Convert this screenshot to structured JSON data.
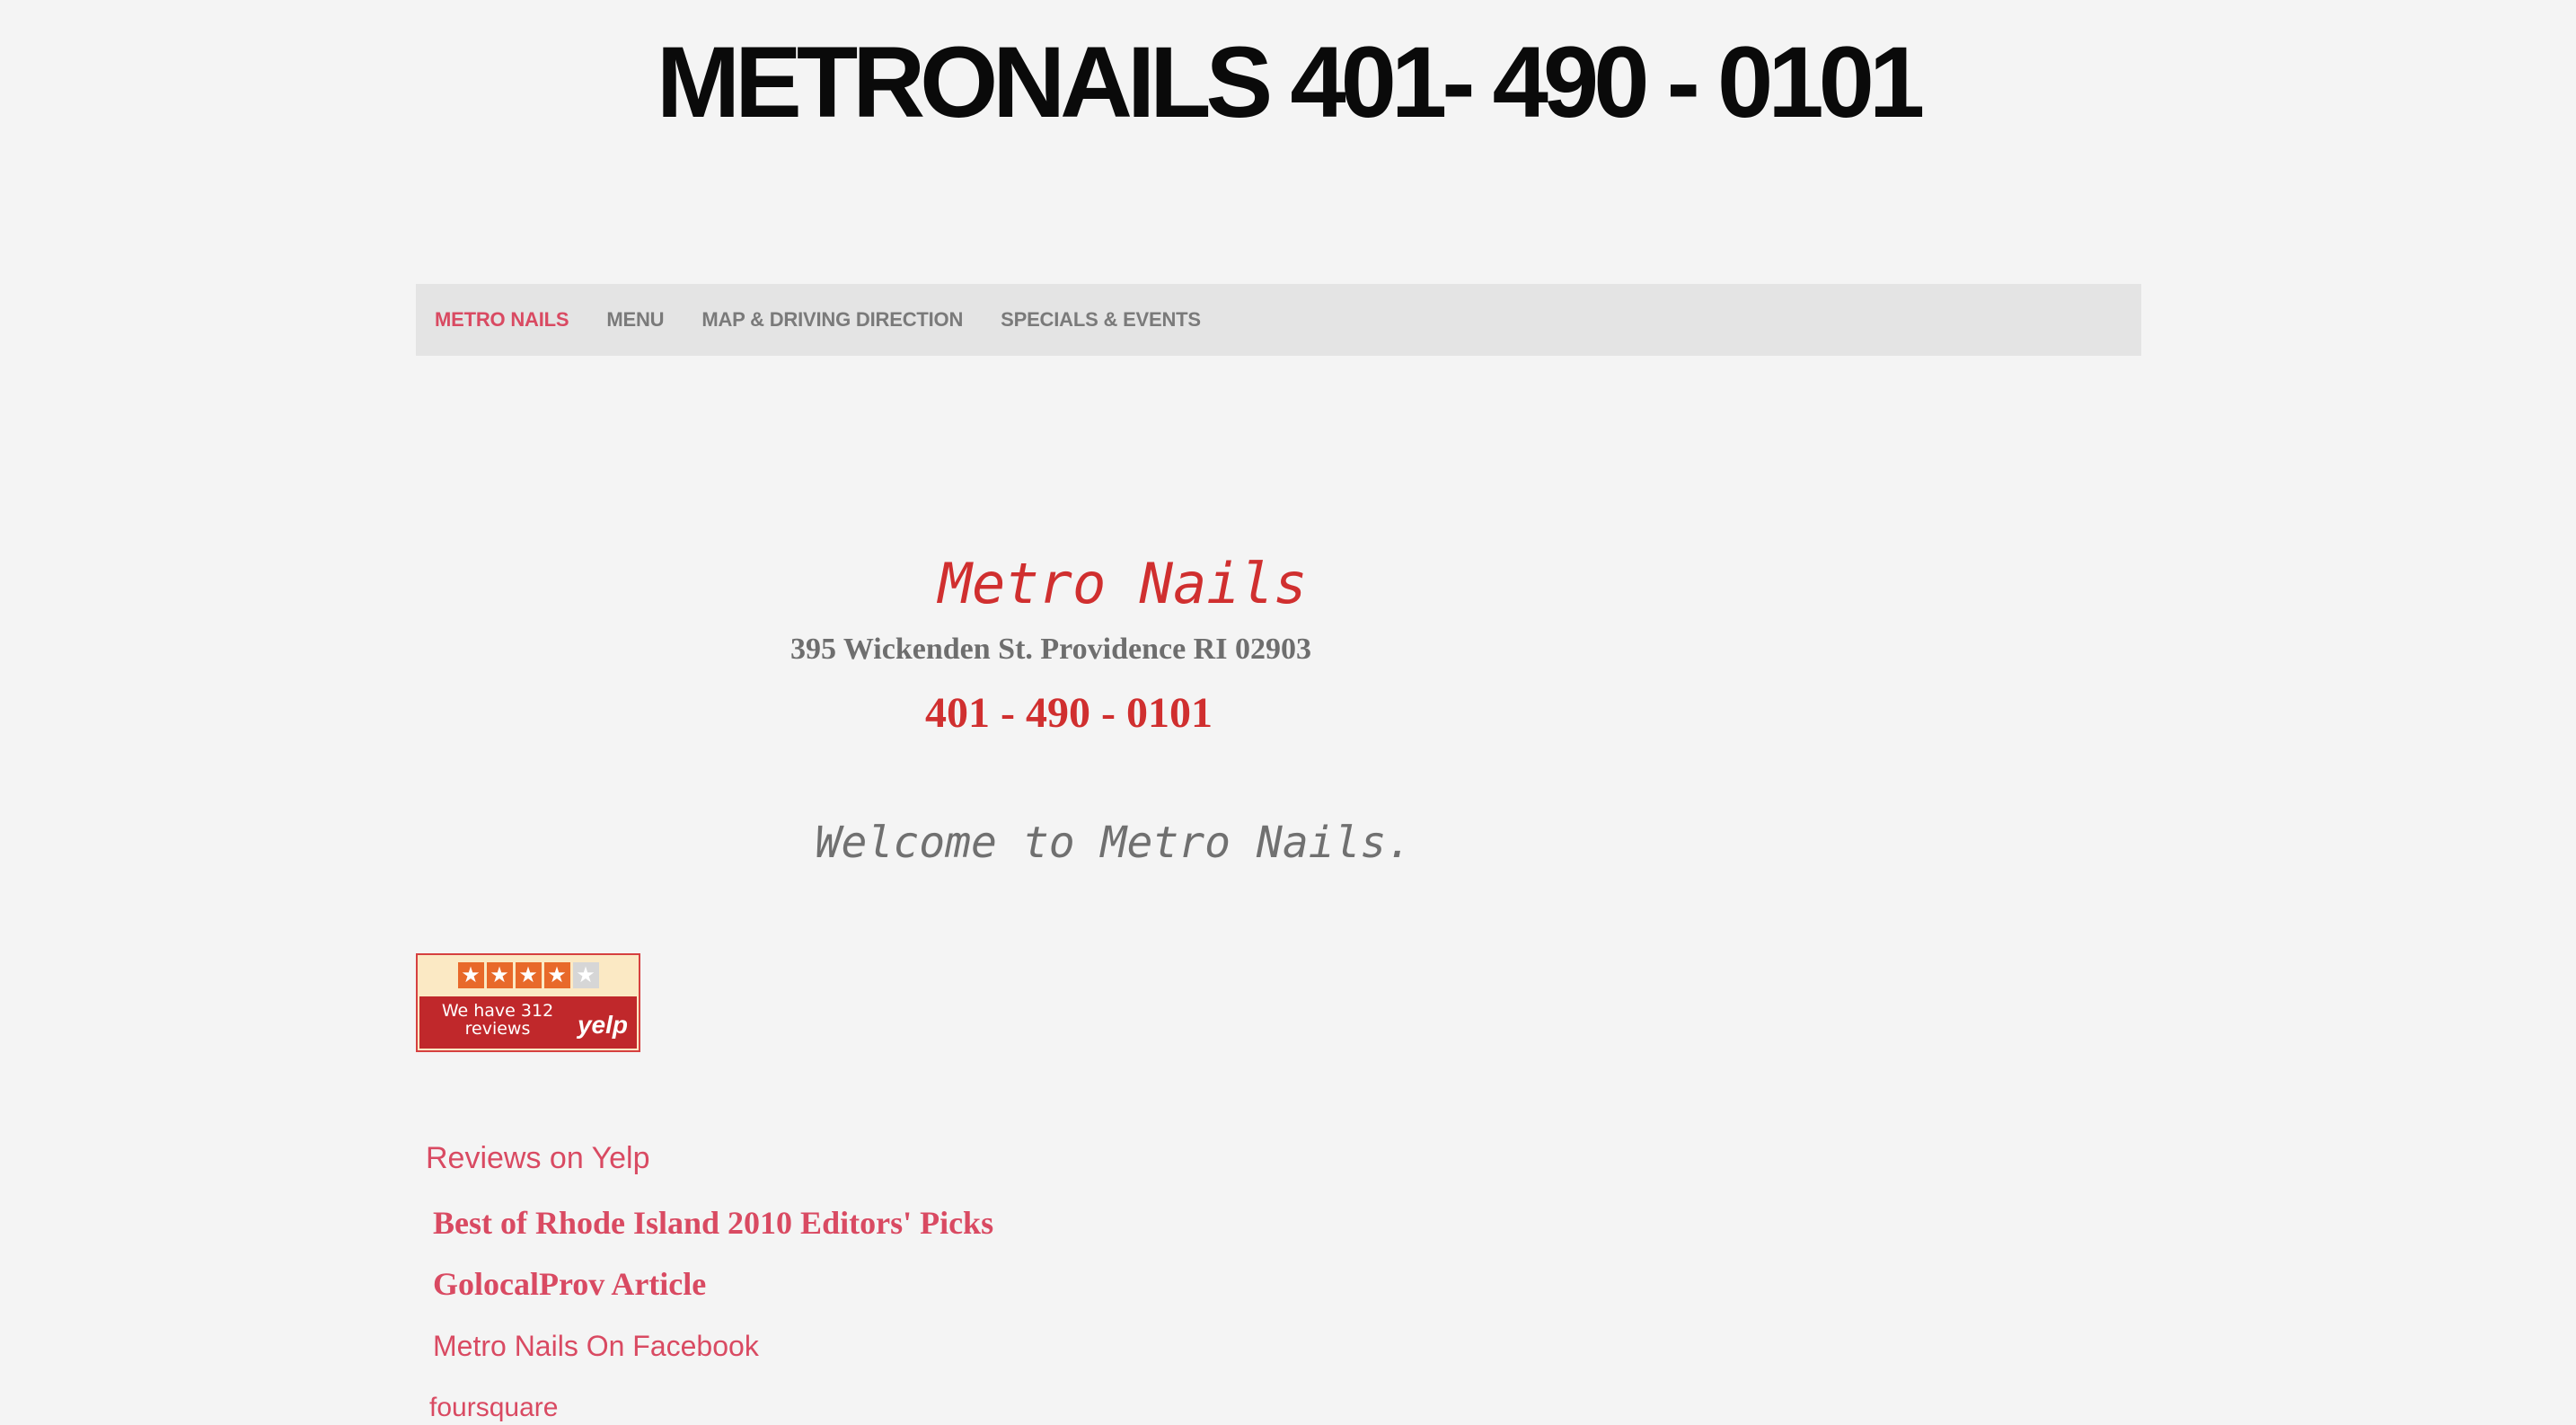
{
  "header": {
    "title": "METRONAILS 401- 490 - 0101"
  },
  "nav": {
    "items": [
      {
        "label": "METRO NAILS"
      },
      {
        "label": "MENU"
      },
      {
        "label": "MAP & DRIVING DIRECTION"
      },
      {
        "label": "SPECIALS & EVENTS"
      }
    ],
    "active_index": 0
  },
  "main": {
    "business_name": "Metro Nails",
    "address": "395 Wickenden St. Providence RI 02903",
    "phone": "401 - 490 - 0101",
    "welcome": "Welcome to Metro Nails."
  },
  "yelp_badge": {
    "rating_stars": 4,
    "max_stars": 5,
    "text_line1": "We have 312",
    "text_line2": "reviews",
    "logo_text": "yelp"
  },
  "links": {
    "reviews_heading": "Reviews on Yelp",
    "best_of": "Best of Rhode Island 2010 Editors' Picks",
    "golocal": "GolocalProv Article",
    "facebook": "Metro Nails On Facebook",
    "foursquare": "foursquare"
  },
  "colors": {
    "accent_pink": "#d94a62",
    "brand_red": "#d02f2f",
    "background": "#f4f4f4",
    "nav_bar": "#e4e4e4"
  }
}
